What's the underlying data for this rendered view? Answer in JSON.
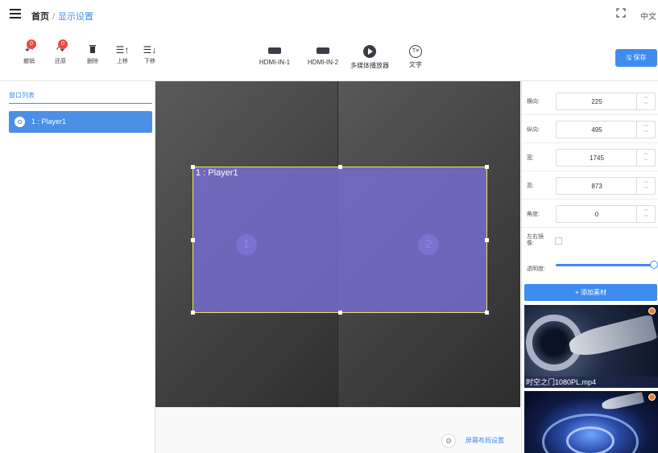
{
  "header": {
    "breadcrumb_home": "首页",
    "breadcrumb_separator": "/",
    "breadcrumb_current": "显示设置",
    "language": "中文"
  },
  "toolbar": {
    "undo": {
      "label": "撤销",
      "count": "0"
    },
    "redo": {
      "label": "还原",
      "count": "0"
    },
    "delete": {
      "label": "删除"
    },
    "move_up": {
      "label": "上移"
    },
    "move_down": {
      "label": "下移"
    },
    "sources": [
      {
        "label": "HDMI-IN-1",
        "icon": "hdmi-icon"
      },
      {
        "label": "HDMI-IN-2",
        "icon": "hdmi-icon"
      },
      {
        "label": "多媒体播放器",
        "icon": "play-icon"
      },
      {
        "label": "文字",
        "icon": "text-icon"
      }
    ],
    "save_label": "保存"
  },
  "left_panel": {
    "tab_label": "窗口列表",
    "items": [
      {
        "label": "1 : Player1",
        "selected": true
      }
    ]
  },
  "canvas": {
    "window_label": "1 : Player1",
    "screens": [
      "1",
      "2"
    ],
    "layout_settings_label": "屏幕布局设置"
  },
  "properties": {
    "x": {
      "label": "横向:",
      "value": "225"
    },
    "y": {
      "label": "纵向:",
      "value": "495"
    },
    "width": {
      "label": "宽:",
      "value": "1745"
    },
    "height": {
      "label": "高:",
      "value": "873"
    },
    "angle": {
      "label": "角度:",
      "value": "0"
    },
    "mirror": {
      "label": "左右镜像:",
      "checked": false
    },
    "opacity": {
      "label": "透明度:",
      "value_percent": 100
    }
  },
  "materials": {
    "add_label": "+ 添加素材",
    "items": [
      {
        "name": "时空之门1080PL.mp4"
      },
      {
        "name": ""
      }
    ]
  },
  "colors": {
    "accent": "#3f8cf0",
    "badge": "#e74c3c",
    "window_fill": "#786ed2",
    "window_border": "#ece36a"
  }
}
